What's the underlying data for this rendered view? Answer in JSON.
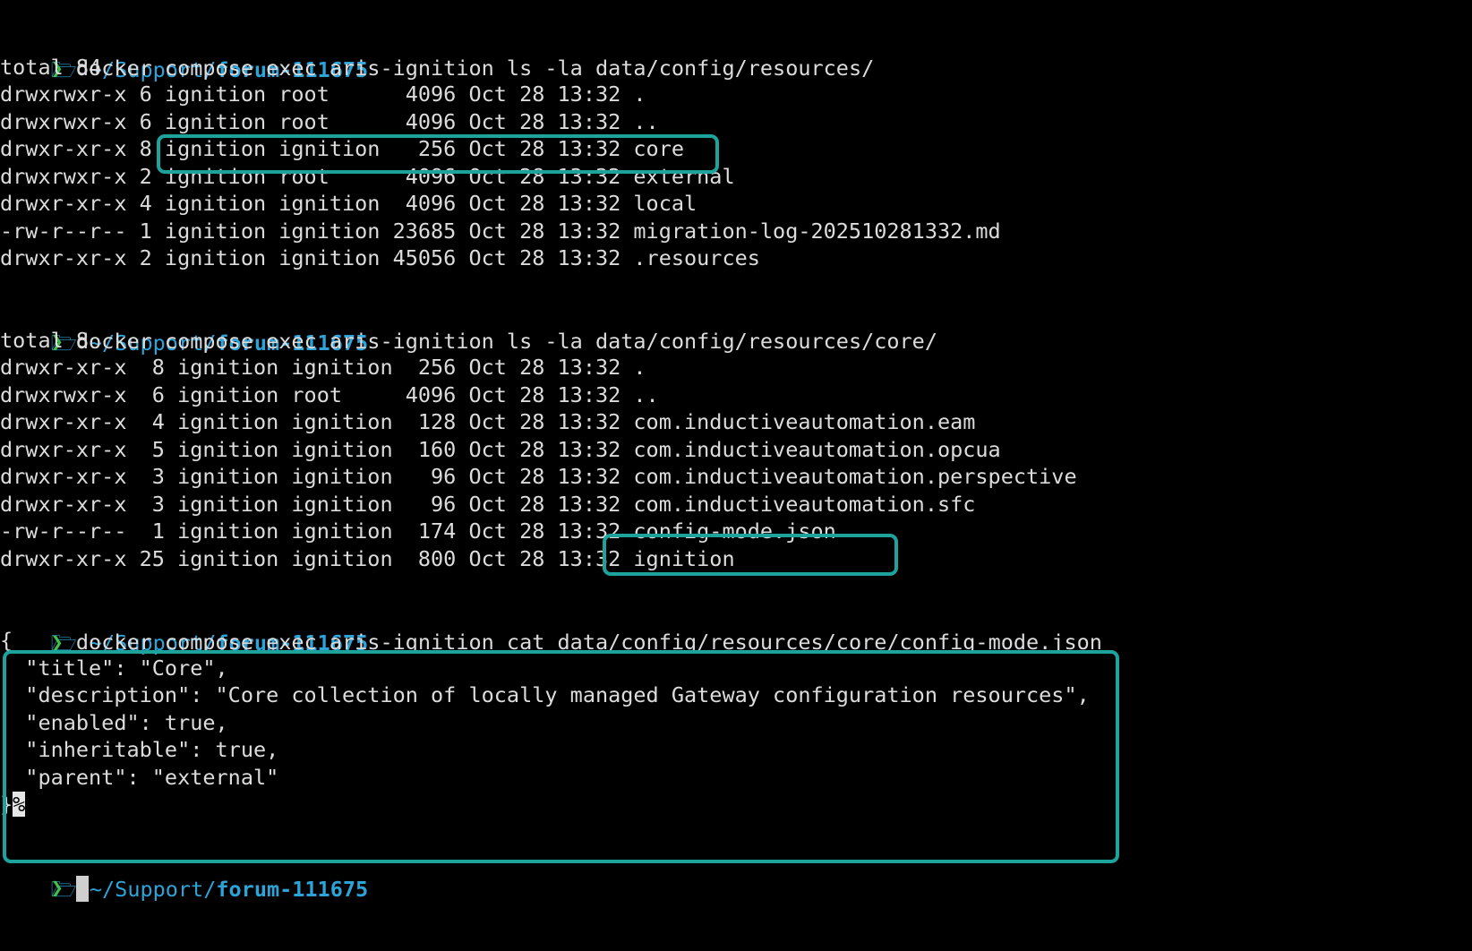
{
  "colors": {
    "background": "#000000",
    "text": "#dcdcdc",
    "path_blue": "#2ea3d8",
    "prompt_green": "#3fc24a",
    "highlight_teal": "#1ea39c"
  },
  "prompt": {
    "apple_glyph": "",
    "folder_icon": "folder-icon",
    "path_prefix": " ~/Support/",
    "dir": "forum-111675",
    "chevron": "❯"
  },
  "commands": {
    "cmd1": " docker compose exec aris-ignition ls -la data/config/resources/",
    "cmd2": " docker compose exec aris-ignition ls -la data/config/resources/core/",
    "cmd3": " docker compose exec aris-ignition cat data/config/resources/core/config-mode.json"
  },
  "listing1": [
    "total 84",
    "drwxrwxr-x 6 ignition root      4096 Oct 28 13:32 .",
    "drwxrwxr-x 6 ignition root      4096 Oct 28 13:32 ..",
    "drwxr-xr-x 8 ignition ignition   256 Oct 28 13:32 core",
    "drwxrwxr-x 2 ignition root      4096 Oct 28 13:32 external",
    "drwxr-xr-x 4 ignition ignition  4096 Oct 28 13:32 local",
    "-rw-r--r-- 1 ignition ignition 23685 Oct 28 13:32 migration-log-202510281332.md",
    "drwxr-xr-x 2 ignition ignition 45056 Oct 28 13:32 .resources"
  ],
  "listing2": [
    "total 8",
    "drwxr-xr-x  8 ignition ignition  256 Oct 28 13:32 .",
    "drwxrwxr-x  6 ignition root     4096 Oct 28 13:32 ..",
    "drwxr-xr-x  4 ignition ignition  128 Oct 28 13:32 com.inductiveautomation.eam",
    "drwxr-xr-x  5 ignition ignition  160 Oct 28 13:32 com.inductiveautomation.opcua",
    "drwxr-xr-x  3 ignition ignition   96 Oct 28 13:32 com.inductiveautomation.perspective",
    "drwxr-xr-x  3 ignition ignition   96 Oct 28 13:32 com.inductiveautomation.sfc",
    "-rw-r--r--  1 ignition ignition  174 Oct 28 13:32 config-mode.json",
    "drwxr-xr-x 25 ignition ignition  800 Oct 28 13:32 ignition"
  ],
  "json_output": [
    "{",
    "  \"title\": \"Core\",",
    "  \"description\": \"Core collection of locally managed Gateway configuration resources\",",
    "  \"enabled\": true,",
    "  \"inheritable\": true,",
    "  \"parent\": \"external\"",
    "}"
  ],
  "end_marker": "%"
}
